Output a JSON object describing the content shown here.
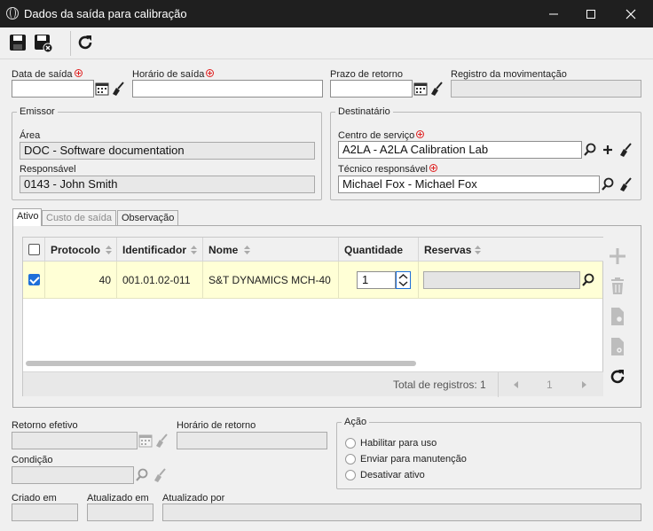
{
  "window": {
    "title": "Dados da saída para calibração"
  },
  "fields": {
    "data_saida": {
      "label": "Data de saída",
      "value": ""
    },
    "horario_saida": {
      "label": "Horário de saída",
      "value": ""
    },
    "prazo_retorno": {
      "label": "Prazo de retorno",
      "value": ""
    },
    "registro_movimentacao": {
      "label": "Registro da movimentação",
      "value": ""
    }
  },
  "emissor": {
    "legend": "Emissor",
    "area_label": "Área",
    "area_value": "DOC - Software documentation",
    "responsavel_label": "Responsável",
    "responsavel_value": "0143 - John Smith"
  },
  "destinatario": {
    "legend": "Destinatário",
    "centro_label": "Centro de serviço",
    "centro_value": "A2LA - A2LA Calibration Lab",
    "tecnico_label": "Técnico responsável",
    "tecnico_value": "Michael Fox - Michael Fox"
  },
  "tabs": [
    {
      "label": "Ativo",
      "active": true
    },
    {
      "label": "Custo de saída",
      "active": false
    },
    {
      "label": "Observação",
      "active": false
    }
  ],
  "grid": {
    "columns": [
      "Protocolo",
      "Identificador",
      "Nome",
      "Quantidade",
      "Reservas"
    ],
    "rows": [
      {
        "checked": true,
        "protocolo": "40",
        "identificador": "001.01.02-011",
        "nome": "S&T DYNAMICS MCH-40",
        "quantidade": "1",
        "reservas": ""
      }
    ],
    "total_label": "Total de registros: 1",
    "page": "1"
  },
  "bottom": {
    "retorno_efetivo_label": "Retorno efetivo",
    "horario_retorno_label": "Horário de retorno",
    "condicao_label": "Condição",
    "criado_em_label": "Criado em",
    "atualizado_em_label": "Atualizado em",
    "atualizado_por_label": "Atualizado por"
  },
  "acao": {
    "legend": "Ação",
    "options": [
      "Habilitar para uso",
      "Enviar para manutenção",
      "Desativar ativo"
    ]
  },
  "colors": {
    "titlebar": "#1f1f1f",
    "row_highlight": "#ffffd6",
    "required": "#e02020",
    "accent": "#1e6fd9"
  }
}
